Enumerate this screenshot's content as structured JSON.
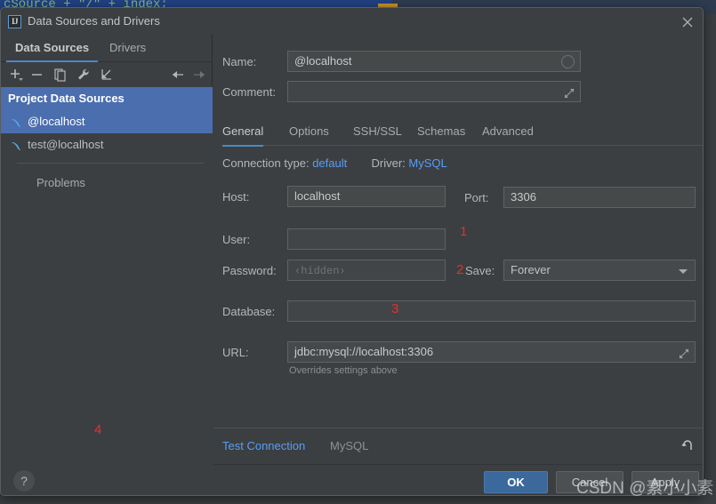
{
  "background": {
    "code_text": "cSource + \"/\" + index;"
  },
  "dialog": {
    "title": "Data Sources and Drivers",
    "logo_text": "IJ",
    "close_icon": "close-icon"
  },
  "left_panel": {
    "tabs": [
      {
        "label": "Data Sources",
        "active": true
      },
      {
        "label": "Drivers",
        "active": false
      }
    ],
    "toolbar": [
      {
        "name": "add-icon",
        "glyph": "+"
      },
      {
        "name": "remove-icon",
        "glyph": "−"
      },
      {
        "name": "duplicate-icon",
        "glyph": "copy"
      },
      {
        "name": "properties-wrench-icon",
        "glyph": "wrench"
      },
      {
        "name": "import-icon",
        "glyph": "import"
      },
      {
        "name": "back-arrow-icon",
        "glyph": "←"
      },
      {
        "name": "forward-arrow-icon",
        "glyph": "→"
      }
    ],
    "group_label": "Project Data Sources",
    "items": [
      {
        "label": "@localhost",
        "selected": true,
        "icon": "mysql-dolphin-icon"
      },
      {
        "label": "test@localhost",
        "selected": false,
        "icon": "mysql-dolphin-icon"
      }
    ],
    "problems_label": "Problems"
  },
  "form": {
    "name_label": "Name:",
    "name_value": "@localhost",
    "comment_label": "Comment:",
    "comment_value": "",
    "tabs": [
      {
        "label": "General",
        "active": true
      },
      {
        "label": "Options",
        "active": false
      },
      {
        "label": "SSH/SSL",
        "active": false
      },
      {
        "label": "Schemas",
        "active": false
      },
      {
        "label": "Advanced",
        "active": false
      }
    ],
    "connection_type_label": "Connection type:",
    "connection_type_value": "default",
    "driver_label": "Driver:",
    "driver_value": "MySQL",
    "host_label": "Host:",
    "host_value": "localhost",
    "port_label": "Port:",
    "port_value": "3306",
    "user_label": "User:",
    "user_value": "",
    "password_label": "Password:",
    "password_placeholder": "‹hidden›",
    "save_label": "Save:",
    "save_value": "Forever",
    "database_label": "Database:",
    "database_value": "",
    "url_label": "URL:",
    "url_value": "jdbc:mysql://localhost:3306",
    "url_hint": "Overrides settings above"
  },
  "annotations": [
    {
      "text": "1"
    },
    {
      "text": "2"
    },
    {
      "text": "3"
    },
    {
      "text": "4"
    }
  ],
  "action_bar": {
    "test_connection_label": "Test Connection",
    "driver_name_label": "MySQL",
    "revert_icon": "revert-arrow-icon"
  },
  "footer": {
    "help_label": "?",
    "ok_label": "OK",
    "cancel_label": "Cancel",
    "apply_label": "Apply"
  },
  "watermark": {
    "text": "CSDN @素小小素"
  },
  "colors": {
    "accent_blue": "#4a88c7",
    "link_blue": "#589df6",
    "selection_blue": "#4b6eaf",
    "primary_button": "#3c699c",
    "annotation_red": "#e03131",
    "panel_bg": "#3c3f41",
    "field_bg": "#45494a"
  }
}
